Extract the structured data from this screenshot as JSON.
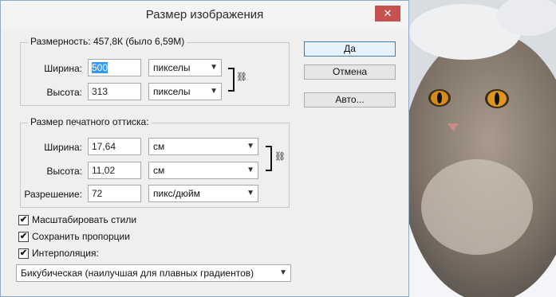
{
  "dialog": {
    "title": "Размер изображения",
    "close_glyph": "✕"
  },
  "pixel_group": {
    "legend": "Размерность:  457,8К (было 6,59М)",
    "width_label": "Ширина:",
    "width_value": "500",
    "width_unit": "пикселы",
    "height_label": "Высота:",
    "height_value": "313",
    "height_unit": "пикселы"
  },
  "print_group": {
    "legend": "Размер печатного оттиска:",
    "width_label": "Ширина:",
    "width_value": "17,64",
    "width_unit": "см",
    "height_label": "Высота:",
    "height_value": "11,02",
    "height_unit": "см",
    "resolution_label": "Разрешение:",
    "resolution_value": "72",
    "resolution_unit": "пикс/дюйм"
  },
  "buttons": {
    "ok": "Да",
    "cancel": "Отмена",
    "auto": "Авто..."
  },
  "options": {
    "scale_styles": "Масштабировать стили",
    "constrain": "Сохранить пропорции",
    "resample": "Интерполяция:",
    "resample_method": "Бикубическая (наилучшая для плавных градиентов)"
  },
  "icons": {
    "checkmark": "✔",
    "dropdown": "▼",
    "chain": "⛓"
  },
  "colors": {
    "accent": "#3399ff",
    "close": "#c75050"
  }
}
